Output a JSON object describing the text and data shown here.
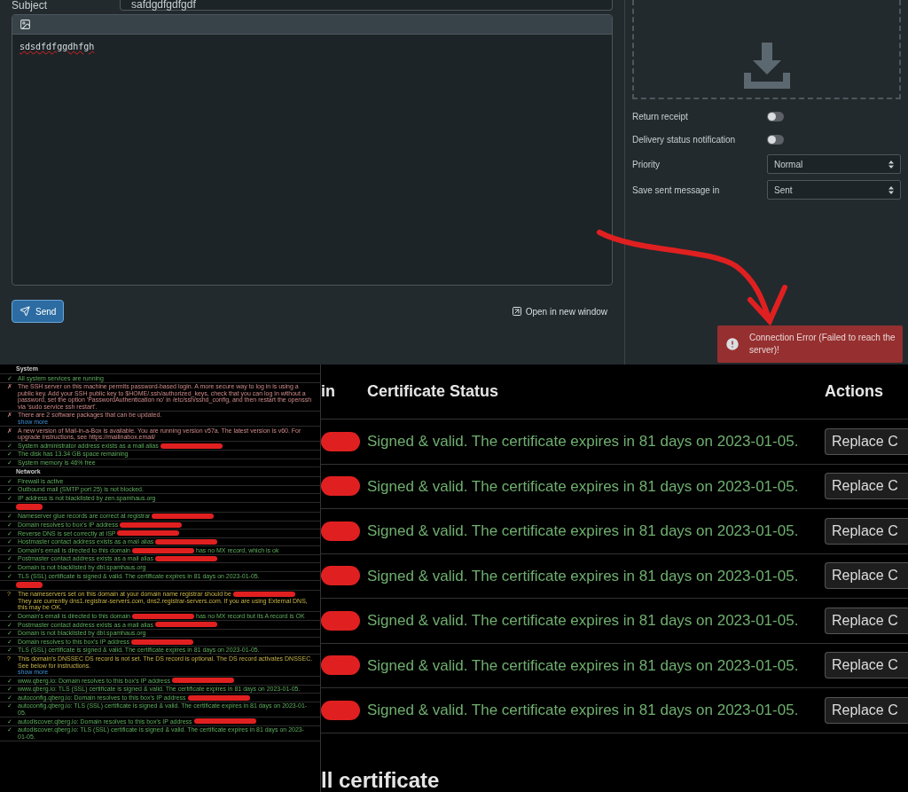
{
  "compose": {
    "subject_label": "Subject",
    "subject_value": "safdgdfgdfgdf",
    "body": "sdsdfdfggdhfgh",
    "send_button": "Send",
    "open_link": "Open in new window"
  },
  "options": {
    "toggles": [
      {
        "label": "Return receipt",
        "on": false
      },
      {
        "label": "Delivery status notification",
        "on": false
      }
    ],
    "selects": [
      {
        "label": "Priority",
        "value": "Normal"
      },
      {
        "label": "Save sent message in",
        "value": "Sent"
      }
    ]
  },
  "toast": {
    "message": "Connection Error (Failed to reach the server)!"
  },
  "status_checks": {
    "sections": [
      {
        "heading": "System",
        "items": [
          {
            "kind": "ok",
            "mark": "✓",
            "text": "All system services are running"
          },
          {
            "kind": "error",
            "mark": "✗",
            "text": "The SSH server on this machine permits password-based login. A more secure way to log in is using a public key. Add your SSH public key to $HOME/.ssh/authorized_keys, check that you can log in without a password, set the option 'PasswordAuthentication no' in /etc/ssh/sshd_config, and then restart the openssh via 'sudo service ssh restart'."
          },
          {
            "kind": "error",
            "mark": "✗",
            "text": "There are 2 software packages that can be updated.",
            "more": "show more"
          },
          {
            "kind": "error",
            "mark": "✗",
            "text": "A new version of Mail-in-a-Box is available. You are running version v57a. The latest version is v60. For upgrade instructions, see https://mailinabox.email/"
          },
          {
            "kind": "ok",
            "mark": "✓",
            "text": "System administrator address exists as a mail alias",
            "redacted": true
          },
          {
            "kind": "ok",
            "mark": "✓",
            "text": "The disk has 13.34 GB space remaining"
          },
          {
            "kind": "ok",
            "mark": "✓",
            "text": "System memory is 46% free"
          }
        ]
      },
      {
        "heading": "Network",
        "items": [
          {
            "kind": "ok",
            "mark": "✓",
            "text": "Firewall is active"
          },
          {
            "kind": "ok",
            "mark": "✓",
            "text": "Outbound mail (SMTP port 25) is not blocked."
          },
          {
            "kind": "ok",
            "mark": "✓",
            "text": "IP address is not blacklisted by zen.spamhaus.org"
          }
        ]
      },
      {
        "heading_redacted": true,
        "items": [
          {
            "kind": "ok",
            "mark": "✓",
            "text": "Nameserver glue records are correct at registrar",
            "redacted": true
          },
          {
            "kind": "ok",
            "mark": "✓",
            "text": "Domain resolves to box's IP address",
            "redacted": true
          },
          {
            "kind": "ok",
            "mark": "✓",
            "text": "Reverse DNS is set correctly at ISP",
            "redacted": true
          },
          {
            "kind": "ok",
            "mark": "✓",
            "text": "Hostmaster contact address exists as a mail alias",
            "redacted": true
          },
          {
            "kind": "ok",
            "mark": "✓",
            "text": "Domain's email is directed to this domain",
            "redacted": true,
            "after": "has no MX record, which is ok"
          },
          {
            "kind": "ok",
            "mark": "✓",
            "text": "Postmaster contact address exists as a mail alias",
            "redacted": true
          },
          {
            "kind": "ok",
            "mark": "✓",
            "text": "Domain is not blacklisted by dbl.spamhaus.org"
          },
          {
            "kind": "ok",
            "mark": "✓",
            "text": "TLS (SSL) certificate is signed & valid. The certificate expires in 81 days on 2023-01-05."
          }
        ]
      },
      {
        "heading_redacted": true,
        "items": [
          {
            "kind": "warning",
            "mark": "?",
            "text": "The nameservers set on this domain at your domain name registrar should be",
            "redacted": true,
            "after": "They are currently dns1.registrar-servers.com, dns2.registrar-servers.com. If you are using External DNS, this may be OK."
          },
          {
            "kind": "ok",
            "mark": "✓",
            "text": "Domain's email is directed to this domain",
            "redacted": true,
            "after": "has no MX record but its A record is OK"
          },
          {
            "kind": "ok",
            "mark": "✓",
            "text": "Postmaster contact address exists as a mail alias",
            "redacted": true
          },
          {
            "kind": "ok",
            "mark": "✓",
            "text": "Domain is not blacklisted by dbl.spamhaus.org"
          },
          {
            "kind": "ok",
            "mark": "✓",
            "text": "Domain resolves to this box's IP address",
            "redacted": true
          },
          {
            "kind": "ok",
            "mark": "✓",
            "text": "TLS (SSL) certificate is signed & valid. The certificate expires in 81 days on 2023-01-05."
          },
          {
            "kind": "warning",
            "mark": "?",
            "text": "This domain's DNSSEC DS record is not set. The DS record is optional. The DS record activates DNSSEC. See below for instructions.",
            "more": "show more"
          },
          {
            "kind": "ok",
            "mark": "✓",
            "text": "www.qberg.io: Domain resolves to this box's IP address",
            "redacted": true
          },
          {
            "kind": "ok",
            "mark": "✓",
            "text": "www.qberg.io: TLS (SSL) certificate is signed & valid. The certificate expires in 81 days on 2023-01-05."
          },
          {
            "kind": "ok",
            "mark": "✓",
            "text": "autoconfig.qberg.io: Domain resolves to this box's IP address",
            "redacted": true
          },
          {
            "kind": "ok",
            "mark": "✓",
            "text": "autoconfig.qberg.io: TLS (SSL) certificate is signed & valid. The certificate expires in 81 days on 2023-01-05."
          },
          {
            "kind": "ok",
            "mark": "✓",
            "text": "autodiscover.qberg.io: Domain resolves to this box's IP address",
            "redacted": true
          },
          {
            "kind": "ok",
            "mark": "✓",
            "text": "autodiscover.qberg.io: TLS (SSL) certificate is signed & valid. The certificate expires in 81 days on 2023-01-05."
          }
        ]
      }
    ]
  },
  "certificates": {
    "columns": [
      "in",
      "Certificate Status",
      "Actions"
    ],
    "rows": [
      {
        "status": "Signed & valid. The certificate expires in 81 days on 2023-01-05.",
        "action": "Replace C"
      },
      {
        "status": "Signed & valid. The certificate expires in 81 days on 2023-01-05.",
        "action": "Replace C"
      },
      {
        "status": "Signed & valid. The certificate expires in 81 days on 2023-01-05.",
        "action": "Replace C"
      },
      {
        "status": "Signed & valid. The certificate expires in 81 days on 2023-01-05.",
        "action": "Replace C"
      },
      {
        "status": "Signed & valid. The certificate expires in 81 days on 2023-01-05.",
        "action": "Replace C"
      },
      {
        "status": "Signed & valid. The certificate expires in 81 days on 2023-01-05.",
        "action": "Replace C"
      },
      {
        "status": "Signed & valid. The certificate expires in 81 days on 2023-01-05.",
        "action": "Replace C"
      }
    ],
    "next_heading": "ll certificate"
  }
}
